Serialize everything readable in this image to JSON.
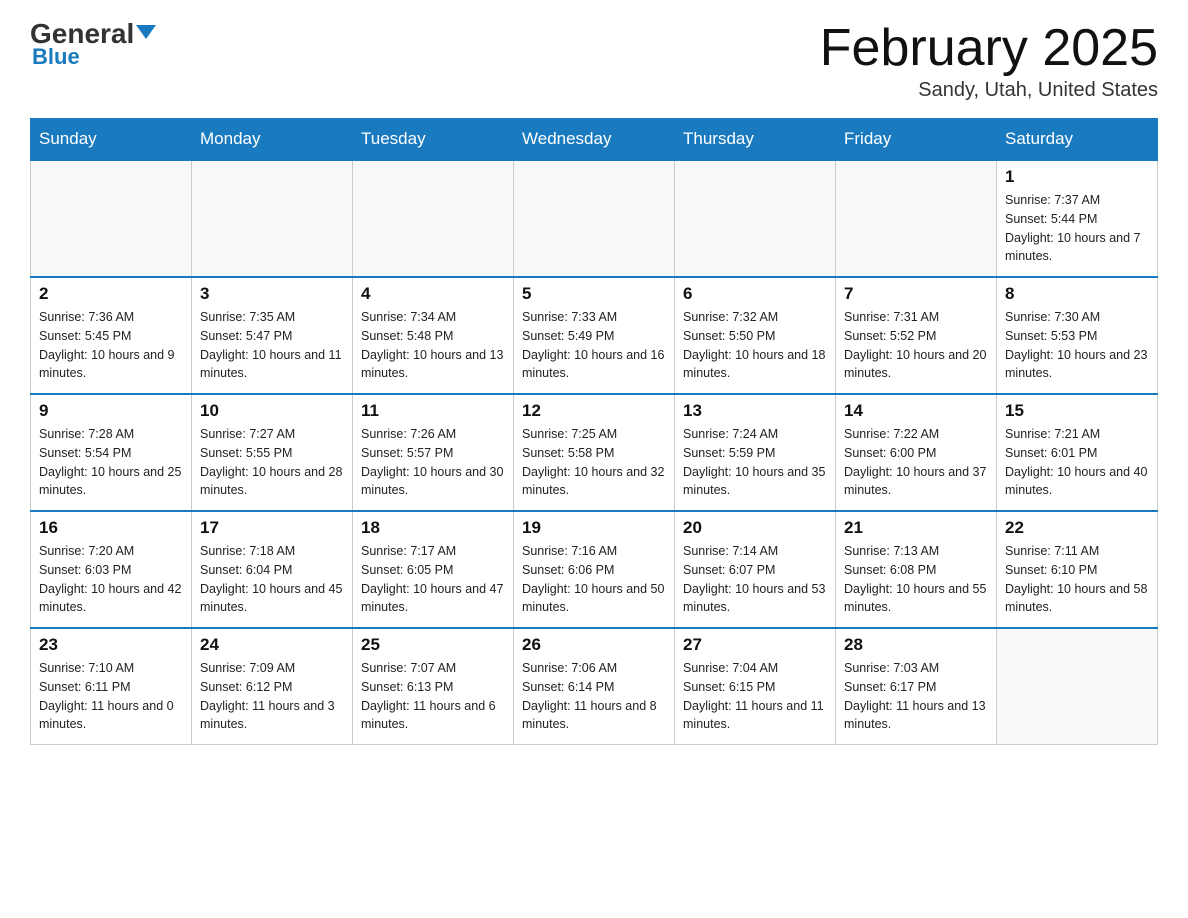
{
  "logo": {
    "general": "General",
    "blue": "Blue"
  },
  "title": "February 2025",
  "location": "Sandy, Utah, United States",
  "days_of_week": [
    "Sunday",
    "Monday",
    "Tuesday",
    "Wednesday",
    "Thursday",
    "Friday",
    "Saturday"
  ],
  "weeks": [
    [
      {
        "day": "",
        "info": ""
      },
      {
        "day": "",
        "info": ""
      },
      {
        "day": "",
        "info": ""
      },
      {
        "day": "",
        "info": ""
      },
      {
        "day": "",
        "info": ""
      },
      {
        "day": "",
        "info": ""
      },
      {
        "day": "1",
        "info": "Sunrise: 7:37 AM\nSunset: 5:44 PM\nDaylight: 10 hours and 7 minutes."
      }
    ],
    [
      {
        "day": "2",
        "info": "Sunrise: 7:36 AM\nSunset: 5:45 PM\nDaylight: 10 hours and 9 minutes."
      },
      {
        "day": "3",
        "info": "Sunrise: 7:35 AM\nSunset: 5:47 PM\nDaylight: 10 hours and 11 minutes."
      },
      {
        "day": "4",
        "info": "Sunrise: 7:34 AM\nSunset: 5:48 PM\nDaylight: 10 hours and 13 minutes."
      },
      {
        "day": "5",
        "info": "Sunrise: 7:33 AM\nSunset: 5:49 PM\nDaylight: 10 hours and 16 minutes."
      },
      {
        "day": "6",
        "info": "Sunrise: 7:32 AM\nSunset: 5:50 PM\nDaylight: 10 hours and 18 minutes."
      },
      {
        "day": "7",
        "info": "Sunrise: 7:31 AM\nSunset: 5:52 PM\nDaylight: 10 hours and 20 minutes."
      },
      {
        "day": "8",
        "info": "Sunrise: 7:30 AM\nSunset: 5:53 PM\nDaylight: 10 hours and 23 minutes."
      }
    ],
    [
      {
        "day": "9",
        "info": "Sunrise: 7:28 AM\nSunset: 5:54 PM\nDaylight: 10 hours and 25 minutes."
      },
      {
        "day": "10",
        "info": "Sunrise: 7:27 AM\nSunset: 5:55 PM\nDaylight: 10 hours and 28 minutes."
      },
      {
        "day": "11",
        "info": "Sunrise: 7:26 AM\nSunset: 5:57 PM\nDaylight: 10 hours and 30 minutes."
      },
      {
        "day": "12",
        "info": "Sunrise: 7:25 AM\nSunset: 5:58 PM\nDaylight: 10 hours and 32 minutes."
      },
      {
        "day": "13",
        "info": "Sunrise: 7:24 AM\nSunset: 5:59 PM\nDaylight: 10 hours and 35 minutes."
      },
      {
        "day": "14",
        "info": "Sunrise: 7:22 AM\nSunset: 6:00 PM\nDaylight: 10 hours and 37 minutes."
      },
      {
        "day": "15",
        "info": "Sunrise: 7:21 AM\nSunset: 6:01 PM\nDaylight: 10 hours and 40 minutes."
      }
    ],
    [
      {
        "day": "16",
        "info": "Sunrise: 7:20 AM\nSunset: 6:03 PM\nDaylight: 10 hours and 42 minutes."
      },
      {
        "day": "17",
        "info": "Sunrise: 7:18 AM\nSunset: 6:04 PM\nDaylight: 10 hours and 45 minutes."
      },
      {
        "day": "18",
        "info": "Sunrise: 7:17 AM\nSunset: 6:05 PM\nDaylight: 10 hours and 47 minutes."
      },
      {
        "day": "19",
        "info": "Sunrise: 7:16 AM\nSunset: 6:06 PM\nDaylight: 10 hours and 50 minutes."
      },
      {
        "day": "20",
        "info": "Sunrise: 7:14 AM\nSunset: 6:07 PM\nDaylight: 10 hours and 53 minutes."
      },
      {
        "day": "21",
        "info": "Sunrise: 7:13 AM\nSunset: 6:08 PM\nDaylight: 10 hours and 55 minutes."
      },
      {
        "day": "22",
        "info": "Sunrise: 7:11 AM\nSunset: 6:10 PM\nDaylight: 10 hours and 58 minutes."
      }
    ],
    [
      {
        "day": "23",
        "info": "Sunrise: 7:10 AM\nSunset: 6:11 PM\nDaylight: 11 hours and 0 minutes."
      },
      {
        "day": "24",
        "info": "Sunrise: 7:09 AM\nSunset: 6:12 PM\nDaylight: 11 hours and 3 minutes."
      },
      {
        "day": "25",
        "info": "Sunrise: 7:07 AM\nSunset: 6:13 PM\nDaylight: 11 hours and 6 minutes."
      },
      {
        "day": "26",
        "info": "Sunrise: 7:06 AM\nSunset: 6:14 PM\nDaylight: 11 hours and 8 minutes."
      },
      {
        "day": "27",
        "info": "Sunrise: 7:04 AM\nSunset: 6:15 PM\nDaylight: 11 hours and 11 minutes."
      },
      {
        "day": "28",
        "info": "Sunrise: 7:03 AM\nSunset: 6:17 PM\nDaylight: 11 hours and 13 minutes."
      },
      {
        "day": "",
        "info": ""
      }
    ]
  ]
}
